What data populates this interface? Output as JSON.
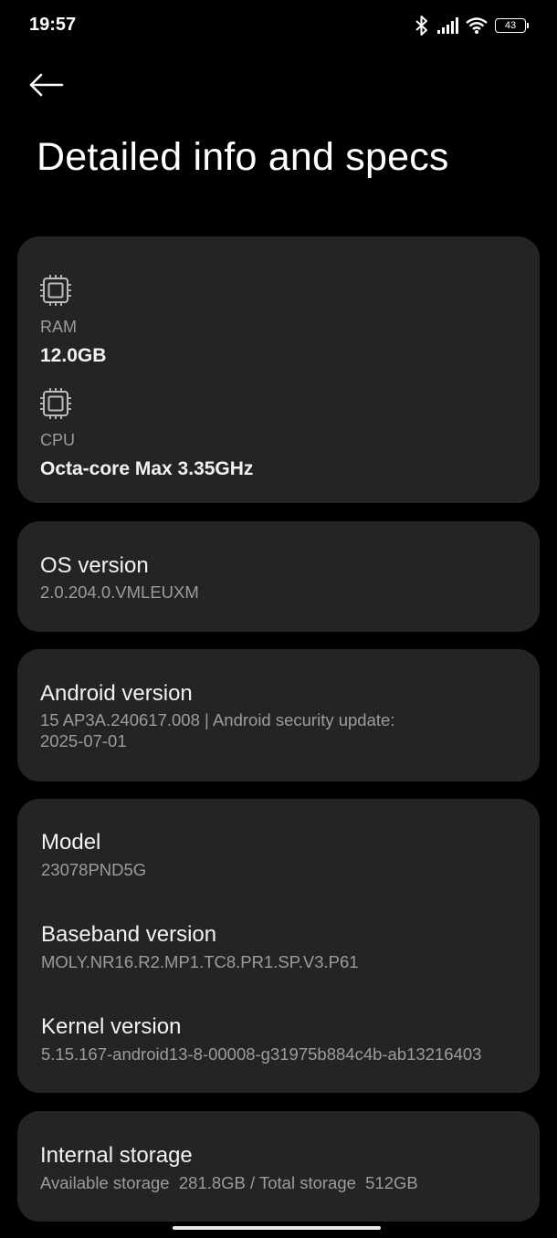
{
  "status_bar": {
    "time": "19:57",
    "battery_level": "43",
    "icons": [
      "bluetooth-icon",
      "signal-icon",
      "wifi-icon",
      "battery-icon"
    ]
  },
  "header": {
    "back_icon": "arrow-left-icon",
    "title": "Detailed info and specs"
  },
  "specs_card": {
    "ram": {
      "icon": "chip-icon",
      "label": "RAM",
      "value": "12.0GB"
    },
    "cpu": {
      "icon": "chip-icon",
      "label": "CPU",
      "value": "Octa-core Max 3.35GHz"
    }
  },
  "os_card": {
    "title": "OS version",
    "value": "2.0.204.0.VMLEUXM"
  },
  "android_card": {
    "title": "Android version",
    "value_line1": "15 AP3A.240617.008 | Android security update:",
    "value_line2": "2025-07-01"
  },
  "device_card": {
    "model": {
      "title": "Model",
      "value": "23078PND5G"
    },
    "baseband": {
      "title": "Baseband version",
      "value": "MOLY.NR16.R2.MP1.TC8.PR1.SP.V3.P61"
    },
    "kernel": {
      "title": "Kernel version",
      "value": "5.15.167-android13-8-00008-g31975b884c4b-ab13216403"
    }
  },
  "storage_card": {
    "title": "Internal storage",
    "value": "Available storage  281.8GB / Total storage  512GB"
  },
  "colors": {
    "background": "#000000",
    "card": "#242424",
    "primary_text": "#f2f2f2",
    "secondary_text": "#9c9c9c"
  }
}
